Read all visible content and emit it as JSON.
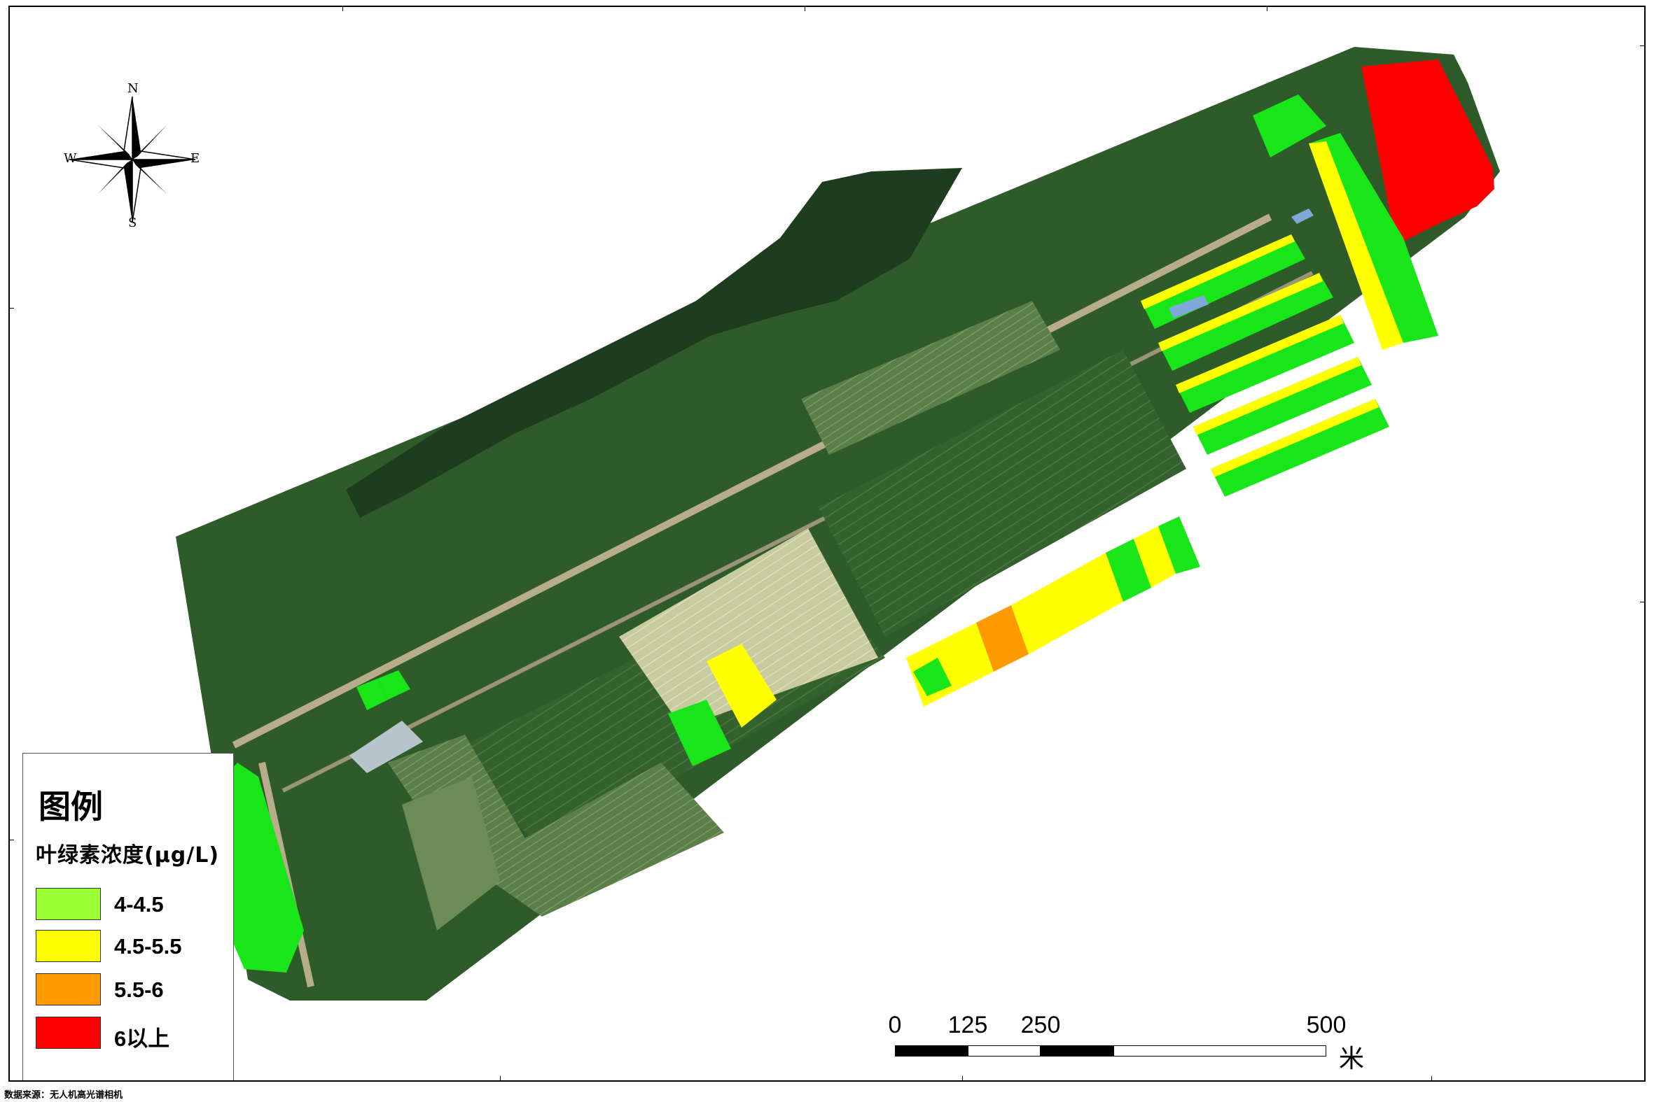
{
  "compass": {
    "north": "N",
    "south": "S",
    "east": "E",
    "west": "W",
    "icon": "compass-rose-icon"
  },
  "legend": {
    "title": "图例",
    "subtitle": "叶绿素浓度(μg/L)",
    "items": [
      {
        "label": "4-4.5",
        "color": "#99ff33"
      },
      {
        "label": "4.5-5.5",
        "color": "#ffff00"
      },
      {
        "label": "5.5-6",
        "color": "#ff9900"
      },
      {
        "label": "6以上",
        "color": "#ff0000"
      }
    ]
  },
  "scale_bar": {
    "labels": [
      "0",
      "125",
      "250",
      "500"
    ],
    "unit": "米"
  },
  "map_colors": {
    "class_4_4_5": "#19e619",
    "class_4_5_5_5": "#ffff00",
    "class_5_5_6": "#ff9900",
    "class_6_plus": "#ff0000",
    "field_dark_green": "#2f5a2a",
    "field_light": "#c9cba0",
    "tree_dark": "#1e3d1f"
  },
  "source_note": "数据来源：无人机高光谱相机"
}
